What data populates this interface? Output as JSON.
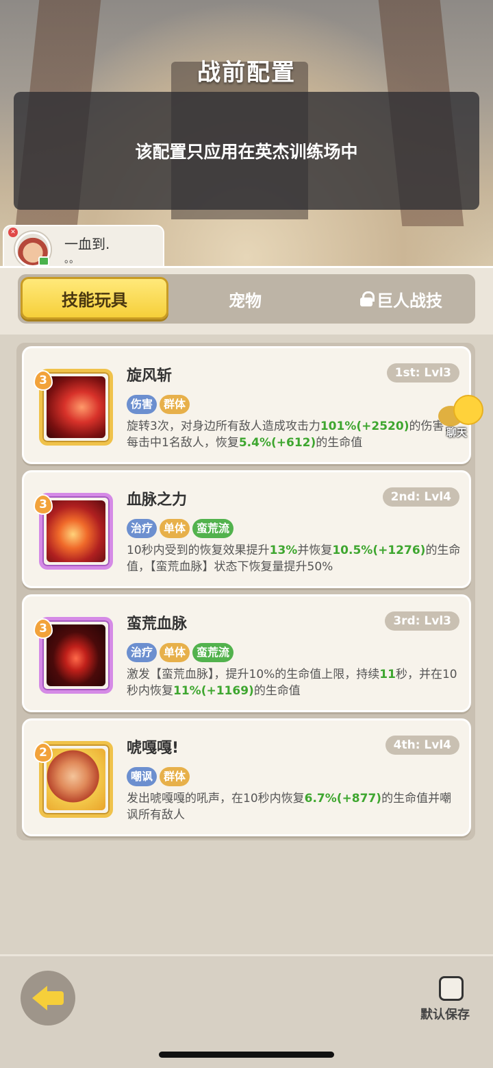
{
  "header": {
    "title": "战前配置",
    "notice": "该配置只应用在英杰训练场中"
  },
  "player": {
    "name": "一血到.",
    "sub": "。。"
  },
  "tabs": [
    {
      "label": "技能玩具",
      "active": true
    },
    {
      "label": "宠物",
      "active": false
    },
    {
      "label": "巨人战技",
      "active": false,
      "locked": true
    }
  ],
  "skills": [
    {
      "level": "3",
      "name": "旋风斩",
      "rank": "1st: Lvl3",
      "tags": [
        "伤害",
        "群体"
      ],
      "desc": [
        "旋转3次，对身边所有敌人造成攻击力",
        "101%",
        "(+2520)",
        "的伤害，每击中1名敌人，恢复",
        "5.4%",
        "(+612)",
        "的生命值"
      ]
    },
    {
      "level": "3",
      "name": "血脉之力",
      "rank": "2nd: Lvl4",
      "tags": [
        "治疗",
        "单体",
        "蛮荒流"
      ],
      "desc": [
        "10秒内受到的恢复效果提升",
        "13%",
        "并恢复",
        "10.5%",
        "(+1276)",
        "的生命值，【蛮荒血脉】状态下恢复量提升50%"
      ]
    },
    {
      "level": "3",
      "name": "蛮荒血脉",
      "rank": "3rd: Lvl3",
      "tags": [
        "治疗",
        "单体",
        "蛮荒流"
      ],
      "desc": [
        "激发【蛮荒血脉】，提升10%的生命值上限，持续",
        "11",
        "秒，并在10秒内恢复",
        "11%",
        "(+1169)",
        "的生命值"
      ]
    },
    {
      "level": "2",
      "name": "唬嘎嘎!",
      "rank": "4th: Lvl4",
      "tags": [
        "嘲讽",
        "群体"
      ],
      "desc": [
        "发出唬嘎嘎的吼声，在10秒内恢复",
        "6.7%",
        "(+877)",
        "的生命值并嘲讽所有敌人"
      ]
    }
  ],
  "chat": {
    "label": "聊天"
  },
  "footer": {
    "default_save_label": "默认保存"
  },
  "colors": {
    "accent_yellow": "#f6cf3a",
    "value_green": "#3ea62f",
    "tag_blue": "#6c8fcf",
    "tag_orange": "#e7b04a",
    "tag_green": "#52b24d"
  }
}
